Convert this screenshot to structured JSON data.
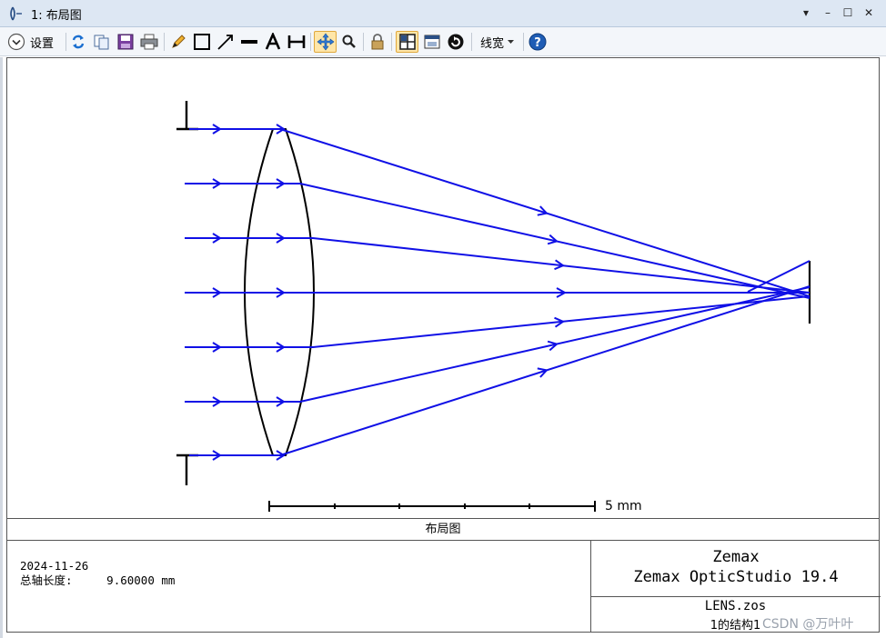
{
  "window": {
    "title": "1: 布局图",
    "controls": [
      "▾",
      "–",
      "☐",
      "✕"
    ]
  },
  "toolbar": {
    "settings_label": "设置",
    "linewidth_label": "线宽",
    "icons": [
      "refresh-icon",
      "copy-icon",
      "save-icon",
      "print-icon",
      "pencil-icon",
      "rectangle-icon",
      "arrow-icon",
      "line-icon",
      "text-icon",
      "dimension-icon",
      "pan-icon",
      "zoom-icon",
      "lock-icon",
      "layout-icon",
      "window-icon",
      "rotate-icon",
      "help-icon"
    ]
  },
  "plot": {
    "scale_label": "5 mm",
    "caption": "布局图"
  },
  "info": {
    "date": "2024-11-26",
    "total_length_label": "总轴长度:",
    "total_length_value": "9.60000 mm",
    "brand": "Zemax",
    "product": "Zemax OpticStudio 19.4",
    "file": "LENS.zos",
    "config": "1的结构1"
  },
  "watermark": "CSDN @万叶叶",
  "colors": {
    "ray": "#1010e6",
    "lens": "#000000",
    "titlebar": "#dde7f3"
  }
}
